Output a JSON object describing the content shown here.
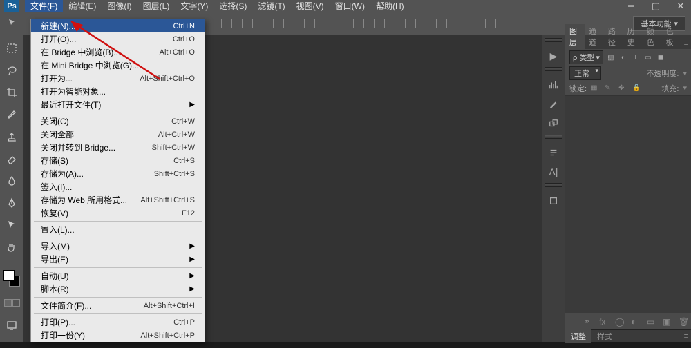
{
  "menubar": {
    "items": [
      {
        "label": "文件(F)",
        "active": true
      },
      {
        "label": "编辑(E)"
      },
      {
        "label": "图像(I)"
      },
      {
        "label": "图层(L)"
      },
      {
        "label": "文字(Y)"
      },
      {
        "label": "选择(S)"
      },
      {
        "label": "滤镜(T)"
      },
      {
        "label": "视图(V)"
      },
      {
        "label": "窗口(W)"
      },
      {
        "label": "帮助(H)"
      }
    ]
  },
  "dropdown": {
    "groups": [
      [
        {
          "label": "新建(N)...",
          "shortcut": "Ctrl+N",
          "hl": true
        },
        {
          "label": "打开(O)...",
          "shortcut": "Ctrl+O"
        },
        {
          "label": "在 Bridge 中浏览(B)...",
          "shortcut": "Alt+Ctrl+O"
        },
        {
          "label": "在 Mini Bridge 中浏览(G)..."
        },
        {
          "label": "打开为...",
          "shortcut": "Alt+Shift+Ctrl+O"
        },
        {
          "label": "打开为智能对象..."
        },
        {
          "label": "最近打开文件(T)",
          "submenu": true
        }
      ],
      [
        {
          "label": "关闭(C)",
          "shortcut": "Ctrl+W"
        },
        {
          "label": "关闭全部",
          "shortcut": "Alt+Ctrl+W"
        },
        {
          "label": "关闭并转到 Bridge...",
          "shortcut": "Shift+Ctrl+W"
        },
        {
          "label": "存储(S)",
          "shortcut": "Ctrl+S"
        },
        {
          "label": "存储为(A)...",
          "shortcut": "Shift+Ctrl+S"
        },
        {
          "label": "签入(I)..."
        },
        {
          "label": "存储为 Web 所用格式...",
          "shortcut": "Alt+Shift+Ctrl+S"
        },
        {
          "label": "恢复(V)",
          "shortcut": "F12"
        }
      ],
      [
        {
          "label": "置入(L)..."
        }
      ],
      [
        {
          "label": "导入(M)",
          "submenu": true
        },
        {
          "label": "导出(E)",
          "submenu": true
        }
      ],
      [
        {
          "label": "自动(U)",
          "submenu": true
        },
        {
          "label": "脚本(R)",
          "submenu": true
        }
      ],
      [
        {
          "label": "文件简介(F)...",
          "shortcut": "Alt+Shift+Ctrl+I"
        }
      ],
      [
        {
          "label": "打印(P)...",
          "shortcut": "Ctrl+P"
        },
        {
          "label": "打印一份(Y)",
          "shortcut": "Alt+Shift+Ctrl+P"
        }
      ]
    ]
  },
  "workspace": {
    "label": "基本功能"
  },
  "right": {
    "tabs": [
      "图层",
      "通道",
      "路径",
      "历史",
      "颜色",
      "色板"
    ],
    "kind_label": "ρ 类型",
    "blend": {
      "mode": "正常",
      "opacity_label": "不透明度:"
    },
    "lock": {
      "label": "锁定:",
      "fill_label": "填充:"
    },
    "bottom_tabs": [
      "调整",
      "样式"
    ]
  }
}
